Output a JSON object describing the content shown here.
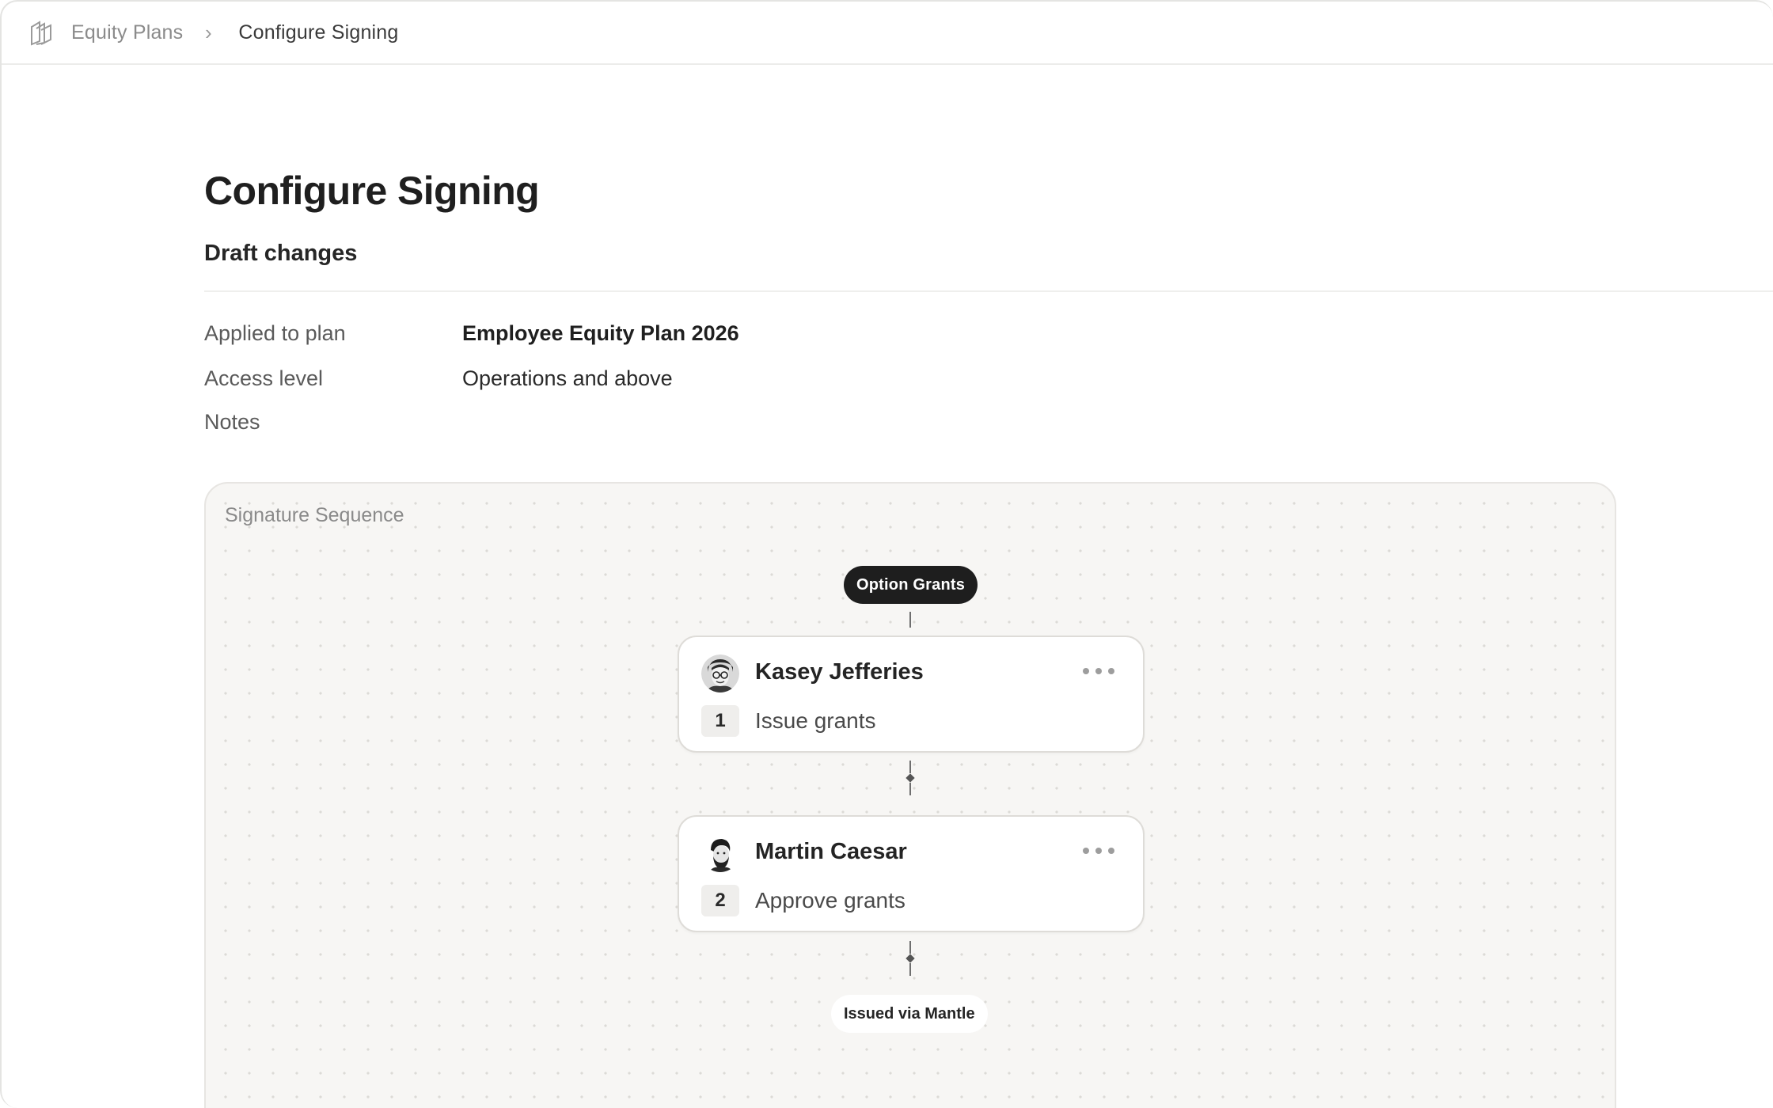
{
  "breadcrumb": {
    "items": [
      "Equity Plans",
      "Configure Signing"
    ],
    "separator": "›"
  },
  "page": {
    "title": "Configure Signing",
    "section": "Draft changes"
  },
  "meta": {
    "applied_label": "Applied to plan",
    "applied_value": "Employee Equity Plan 2026",
    "access_label": "Access level",
    "access_value": "Operations and above",
    "notes_label": "Notes",
    "notes_value": ""
  },
  "sequence": {
    "label": "Signature Sequence",
    "start_label": "Option Grants",
    "end_label": "Issued via Mantle",
    "steps": [
      {
        "number": "1",
        "name": "Kasey Jefferies",
        "action": "Issue grants"
      },
      {
        "number": "2",
        "name": "Martin Caesar",
        "action": "Approve grants"
      }
    ]
  },
  "icons": {
    "logo": "logo-icon",
    "separator": "chevron-right-icon",
    "more": "more-horizontal-icon"
  },
  "colors": {
    "pill_dark_bg": "#1e1e1e",
    "canvas_bg": "#f7f6f4",
    "text_primary": "#1f1f1f",
    "text_muted": "#8b8b8b"
  }
}
